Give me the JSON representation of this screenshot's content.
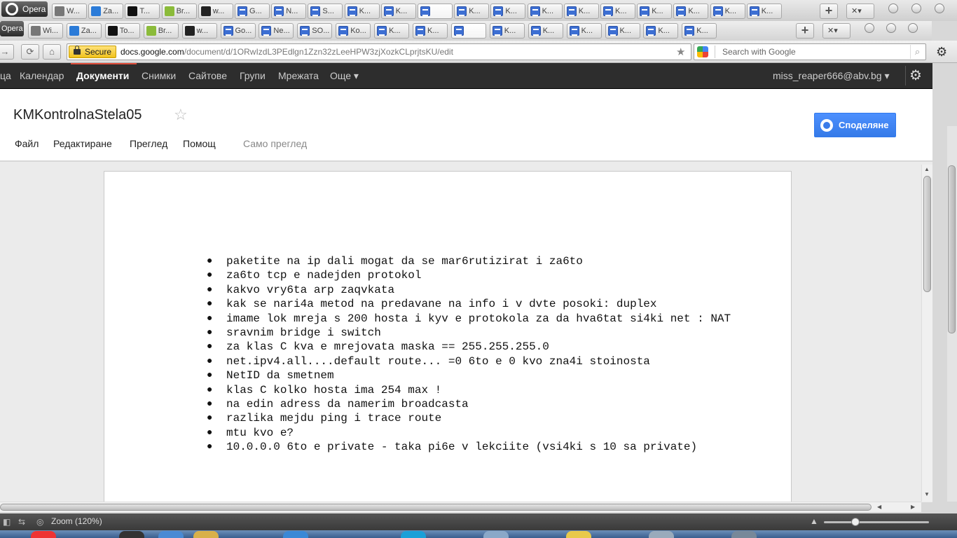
{
  "browser": {
    "opera_label": "Opera",
    "tabs_row1": [
      "W...",
      "Za...",
      "T...",
      "Br...",
      "w...",
      "G...",
      "N...",
      "S...",
      "K...",
      "K...",
      "",
      "K...",
      "K...",
      "K...",
      "K...",
      "K...",
      "K...",
      "K...",
      "K...",
      "K..."
    ],
    "tabs_row2": [
      "Wi...",
      "Za...",
      "To...",
      "Br...",
      "w...",
      "Go...",
      "Ne...",
      "SO...",
      "Ko...",
      "K...",
      "K...",
      "",
      "K...",
      "K...",
      "K...",
      "K...",
      "K...",
      "K..."
    ],
    "secure_label": "Secure",
    "url_host": "docs.google.com",
    "url_path": "/document/d/1ORwIzdL3PEdlgn1Zzn32zLeeHPW3zjXozkCLprjtsKU/edit",
    "search_placeholder": "Search with Google"
  },
  "gbar": {
    "items": [
      "ца",
      "Календар",
      "Документи",
      "Снимки",
      "Сайтове",
      "Групи",
      "Мрежата",
      "Още ▾"
    ],
    "selected": "Документи",
    "account": "miss_reaper666@abv.bg ▾"
  },
  "doc": {
    "title": "KMKontrolnaStela05",
    "menus": [
      "Файл",
      "Редактиране",
      "Преглед",
      "Помощ"
    ],
    "view_only": "Само преглед",
    "share_label": "Споделяне",
    "bullets": [
      "paketite na ip dali mogat da se mar6rutizirat i za6to",
      "za6to tcp e nadejden protokol",
      "kakvo vry6ta arp zaqvkata",
      "kak se nari4a metod na predavane na info i v dvte posoki: duplex",
      "imame lok mreja s 200 hosta i kyv e protokola za da hva6tat si4ki net : NAT",
      "sravnim bridge i switch",
      "za klas C kva e mrejovata maska == 255.255.255.0",
      "net.ipv4.all....default route... =0 6to e 0 kvo zna4i stoinosta",
      "NetID da smetnem",
      "klas C kolko hosta ima  254 max  !",
      "na edin adress da namerim broadcasta",
      "razlika mejdu ping i trace route",
      "mtu kvo e?",
      "10.0.0.0 6to e private - taka pi6e v lekciite (vsi4ki s 10 sa private)"
    ]
  },
  "statusbar": {
    "zoom": "Zoom (120%)",
    "zoom_level": 0.3
  }
}
